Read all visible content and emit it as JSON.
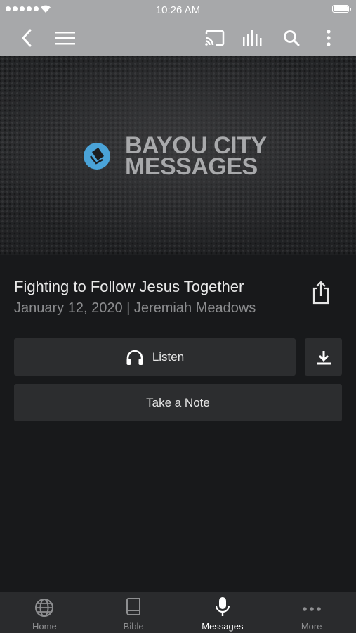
{
  "status_bar": {
    "time": "10:26 AM"
  },
  "nav": {
    "icons": [
      "back-icon",
      "menu-icon",
      "cast-icon",
      "audio-levels-icon",
      "search-icon",
      "more-vertical-icon"
    ]
  },
  "banner": {
    "logo_line1": "BAYOU CITY",
    "logo_line2": "MESSAGES",
    "logo_accent": "#4aa3d8"
  },
  "message": {
    "title": "Fighting to Follow Jesus Together",
    "meta": "January 12, 2020 | Jeremiah Meadows"
  },
  "actions": {
    "listen_label": "Listen",
    "note_label": "Take a Note"
  },
  "tabbar": {
    "tabs": [
      {
        "label": "Home",
        "icon": "globe-icon"
      },
      {
        "label": "Bible",
        "icon": "book-icon"
      },
      {
        "label": "Messages",
        "icon": "microphone-icon",
        "active": true
      },
      {
        "label": "More",
        "icon": "more-horizontal-icon"
      }
    ]
  },
  "colors": {
    "header": "#a7a8aa",
    "background": "#18191b",
    "button": "#2c2d2f",
    "tabbar": "#2a2b2d"
  }
}
